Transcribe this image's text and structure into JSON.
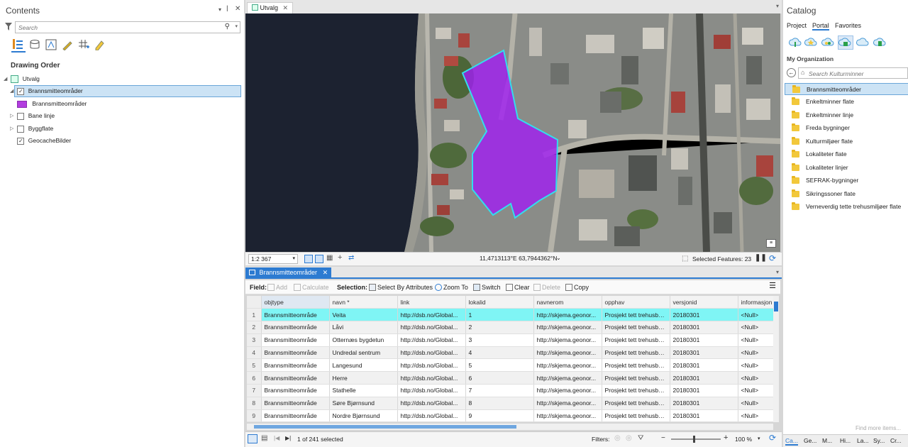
{
  "contents": {
    "title": "Contents",
    "search_placeholder": "Search",
    "drawing_order_label": "Drawing Order",
    "map_name": "Utvalg",
    "layers": [
      {
        "name": "Brannsmitteområder",
        "checked": true,
        "expanded": true,
        "selected": true
      },
      {
        "name": "Bane linje",
        "checked": false,
        "expanded": false
      },
      {
        "name": "Byggflate",
        "checked": false,
        "expanded": false
      },
      {
        "name": "GeocacheBilder",
        "checked": true,
        "expanded": false
      }
    ],
    "legend_label": "Brannsmitteområder",
    "legend_color": "#b23ddf"
  },
  "map": {
    "tab_label": "Utvalg",
    "scale": "1:2 367",
    "coordinates": "11,4713113°E 63,7944362°N",
    "selected_features": "Selected Features: 23",
    "polygon_fill": "#a020f0",
    "polygon_outline": "#33ddee"
  },
  "attr_table": {
    "tab_label": "Brannsmitteområder",
    "field_label": "Field:",
    "add_label": "Add",
    "calculate_label": "Calculate",
    "selection_label": "Selection:",
    "select_by_attr_label": "Select By Attributes",
    "zoom_to_label": "Zoom To",
    "switch_label": "Switch",
    "clear_label": "Clear",
    "delete_label": "Delete",
    "copy_label": "Copy",
    "columns": [
      "objtype",
      "navn *",
      "link",
      "lokalid",
      "navnerom",
      "opphav",
      "versjonid",
      "informasjon"
    ],
    "rows": [
      [
        "1",
        "Brannsmitteområde",
        "Veita",
        "http://dsb.no/Global...",
        "1",
        "http://skjema.geonor...",
        "Prosjekt tett trehusbe...",
        "20180301",
        "<Null>"
      ],
      [
        "2",
        "Brannsmitteområde",
        "Låvi",
        "http://dsb.no/Global...",
        "2",
        "http://skjema.geonor...",
        "Prosjekt tett trehusbe...",
        "20180301",
        "<Null>"
      ],
      [
        "3",
        "Brannsmitteområde",
        "Otternæs bygdetun",
        "http://dsb.no/Global...",
        "3",
        "http://skjema.geonor...",
        "Prosjekt tett trehusbe...",
        "20180301",
        "<Null>"
      ],
      [
        "4",
        "Brannsmitteområde",
        "Undredal sentrum",
        "http://dsb.no/Global...",
        "4",
        "http://skjema.geonor...",
        "Prosjekt tett trehusbe...",
        "20180301",
        "<Null>"
      ],
      [
        "5",
        "Brannsmitteområde",
        "Langesund",
        "http://dsb.no/Global...",
        "5",
        "http://skjema.geonor...",
        "Prosjekt tett trehusbe...",
        "20180301",
        "<Null>"
      ],
      [
        "6",
        "Brannsmitteområde",
        "Herre",
        "http://dsb.no/Global...",
        "6",
        "http://skjema.geonor...",
        "Prosjekt tett trehusbe...",
        "20180301",
        "<Null>"
      ],
      [
        "7",
        "Brannsmitteområde",
        "Stathelle",
        "http://dsb.no/Global...",
        "7",
        "http://skjema.geonor...",
        "Prosjekt tett trehusbe...",
        "20180301",
        "<Null>"
      ],
      [
        "8",
        "Brannsmitteområde",
        "Søre Bjørnsund",
        "http://dsb.no/Global...",
        "8",
        "http://skjema.geonor...",
        "Prosjekt tett trehusbe...",
        "20180301",
        "<Null>"
      ],
      [
        "9",
        "Brannsmitteområde",
        "Nordre Bjørnsund",
        "http://dsb.no/Global...",
        "9",
        "http://skjema.geonor...",
        "Prosjekt tett trehusbe...",
        "20180301",
        "<Null>"
      ]
    ],
    "selected_row_color": "#7ff5f5",
    "status_text": "1 of 241 selected",
    "filters_label": "Filters:",
    "zoom_label": "100 %"
  },
  "catalog": {
    "title": "Catalog",
    "tabs": [
      "Project",
      "Portal",
      "Favorites"
    ],
    "active_tab": "Portal",
    "section_label": "My Organization",
    "search_placeholder": "Search Kulturminner",
    "items": [
      "Brannsmitteområder",
      "Enkeltminner flate",
      "Enkeltminner linje",
      "Freda bygninger",
      "Kulturmiljøer flate",
      "Lokaliteter flate",
      "Lokaliteter linjer",
      "SEFRAK-bygninger",
      "Sikringssoner flate",
      "Verneverdig tette trehusmiljøer flate"
    ],
    "find_more": "Find more items...",
    "bottom_tabs": [
      "Ca...",
      "Ge...",
      "M...",
      "Hi...",
      "La...",
      "Sy...",
      "Cr..."
    ]
  }
}
